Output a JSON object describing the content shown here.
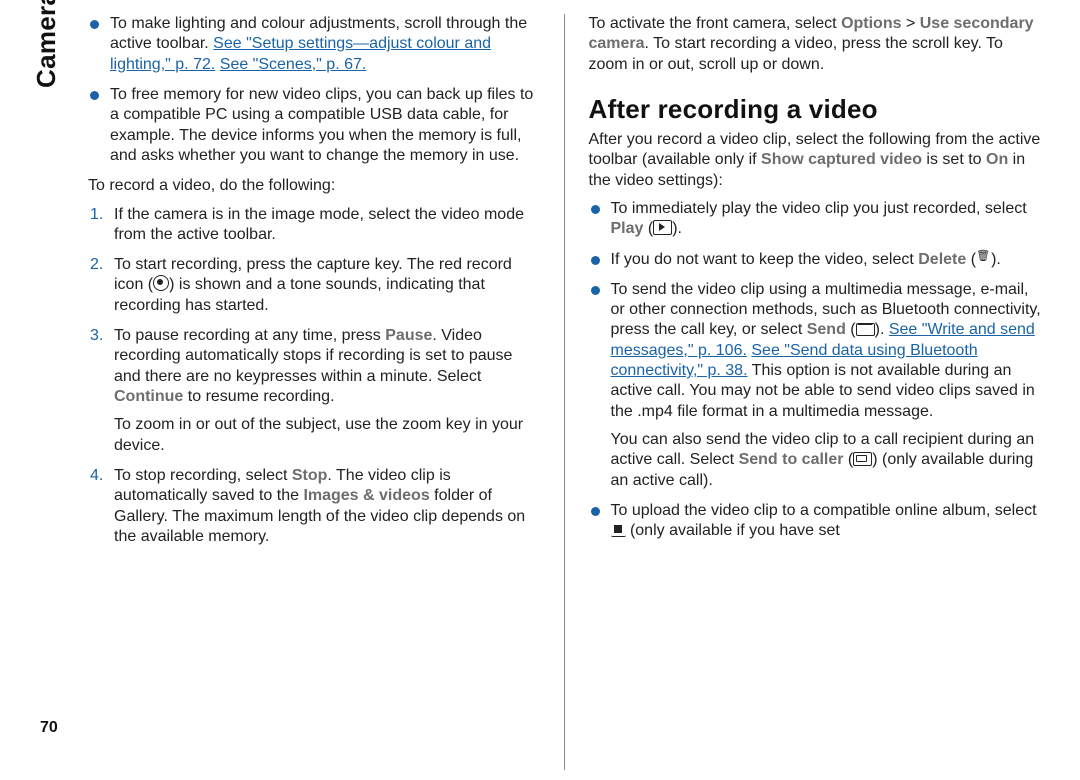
{
  "sidebar": {
    "label": "Camera",
    "page_num": "70"
  },
  "left": {
    "b1_pre": "To make lighting and colour adjustments, scroll through the active toolbar. ",
    "b1_link1": "See \"Setup settings—adjust colour and lighting,\" p. 72.",
    "b1_mid": " ",
    "b1_link2": "See \"Scenes,\" p. 67.",
    "b2": "To free memory for new video clips, you can back up files to a compatible PC using a compatible USB data cable, for example. The device informs you when the memory is full, and asks whether you want to change the memory in use.",
    "intro": "To record a video, do the following:",
    "s1": "If the camera is in the image mode, select the video mode from the active toolbar.",
    "s2a": "To start recording, press the capture key. The red record icon (",
    "s2b": ") is shown and a tone sounds, indicating that recording has started.",
    "s3a": "To pause recording at any time, press ",
    "s3_pause": "Pause",
    "s3b": ". Video recording automatically stops if recording is set to pause and there are no keypresses within a minute. Select ",
    "s3_cont": "Continue",
    "s3c": " to resume recording.",
    "s3_zoom": "To zoom in or out of the subject, use the zoom key in your device.",
    "s4a": "To stop recording, select ",
    "s4_stop": "Stop",
    "s4b": ". The video clip is automatically saved to the ",
    "s4_iv": "Images & videos",
    "s4c": " folder of Gallery. The maximum length of the video clip depends on the available memory."
  },
  "right": {
    "top_a": "To activate the front camera, select ",
    "top_opt": "Options",
    "top_gt": " > ",
    "top_use": "Use secondary camera",
    "top_b": ". To start recording a video, press the scroll key. To zoom in or out, scroll up or down.",
    "heading": "After recording a video",
    "intro_a": "After you record a video clip, select the following from the active toolbar (available only if ",
    "intro_show": "Show captured video",
    "intro_b": " is set to ",
    "intro_on": "On",
    "intro_c": " in the video settings):",
    "li1a": "To immediately play the video clip you just recorded, select ",
    "li1_play": "Play",
    "li1b": " (",
    "li1c": ").",
    "li2a": "If you do not want to keep the video, select ",
    "li2_del": "Delete",
    "li2b": " (",
    "li2c": ").",
    "li3a": "To send the video clip using a multimedia message, e-mail, or other connection methods, such as Bluetooth connectivity, press the call key, or select ",
    "li3_send": "Send",
    "li3b": " (",
    "li3c": "). ",
    "li3_link1": "See \"Write and send messages,\" p. 106.",
    "li3_mid": " ",
    "li3_link2": "See \"Send data using Bluetooth connectivity,\" p. 38.",
    "li3d": " This option is not available during an active call. You may not be able to send video clips saved in the .mp4 file format in a multimedia message.",
    "li3_p2a": "You can also send the video clip to a call recipient during an active call. Select ",
    "li3_stc": "Send to caller",
    "li3_p2b": " (",
    "li3_p2c": ") (only available during an active call).",
    "li4a": "To upload the video clip to a compatible online album, select ",
    "li4b": " (only available if you have set"
  }
}
